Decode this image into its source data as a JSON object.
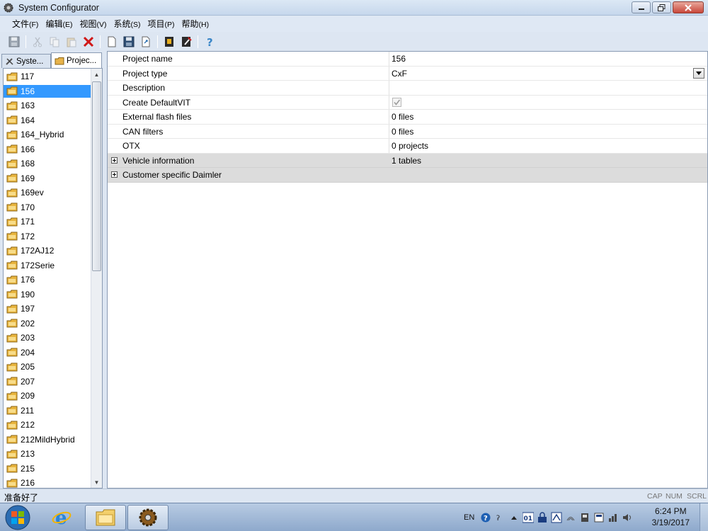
{
  "window": {
    "title": "System Configurator"
  },
  "menu": [
    {
      "label": "文件",
      "accel": "(F)"
    },
    {
      "label": "编辑",
      "accel": "(E)"
    },
    {
      "label": "视图",
      "accel": "(V)"
    },
    {
      "label": "系统",
      "accel": "(S)"
    },
    {
      "label": "项目",
      "accel": "(P)"
    },
    {
      "label": "帮助",
      "accel": "(H)"
    }
  ],
  "toolbar": {
    "icons": [
      "save-icon",
      "cut-icon",
      "copy-icon",
      "paste-icon",
      "delete-icon",
      "new-icon",
      "save-all-icon",
      "export-icon",
      "book-icon",
      "edit-icon",
      "help-icon"
    ]
  },
  "left_panel": {
    "tabs": [
      {
        "label": "Syste..."
      },
      {
        "label": "Projec..."
      }
    ],
    "items": [
      "117",
      "156",
      "163",
      "164",
      "164_Hybrid",
      "166",
      "168",
      "169",
      "169ev",
      "170",
      "171",
      "172",
      "172AJ12",
      "172Serie",
      "176",
      "190",
      "197",
      "202",
      "203",
      "204",
      "205",
      "207",
      "209",
      "211",
      "212",
      "212MildHybrid",
      "213",
      "215",
      "216"
    ],
    "selected": "156"
  },
  "properties": {
    "rows": [
      {
        "name": "Project name",
        "value": "156",
        "group": false
      },
      {
        "name": "Project type",
        "value": "CxF",
        "group": false,
        "dropdown": true
      },
      {
        "name": "Description",
        "value": "",
        "group": false
      },
      {
        "name": "Create DefaultVIT",
        "value": "",
        "group": false,
        "checkbox": true
      },
      {
        "name": "External flash files",
        "value": "0 files",
        "group": false
      },
      {
        "name": "CAN filters",
        "value": "0 files",
        "group": false
      },
      {
        "name": "OTX",
        "value": "0 projects",
        "group": false
      },
      {
        "name": "Vehicle information",
        "value": "1 tables",
        "group": true
      },
      {
        "name": "Customer specific Daimler",
        "value": "",
        "group": true
      }
    ]
  },
  "statusbar": {
    "text": "准备好了",
    "indicators": [
      "CAP",
      "NUM",
      "SCRL"
    ]
  },
  "taskbar": {
    "language": "EN",
    "time": "6:24 PM",
    "date": "3/19/2017"
  }
}
